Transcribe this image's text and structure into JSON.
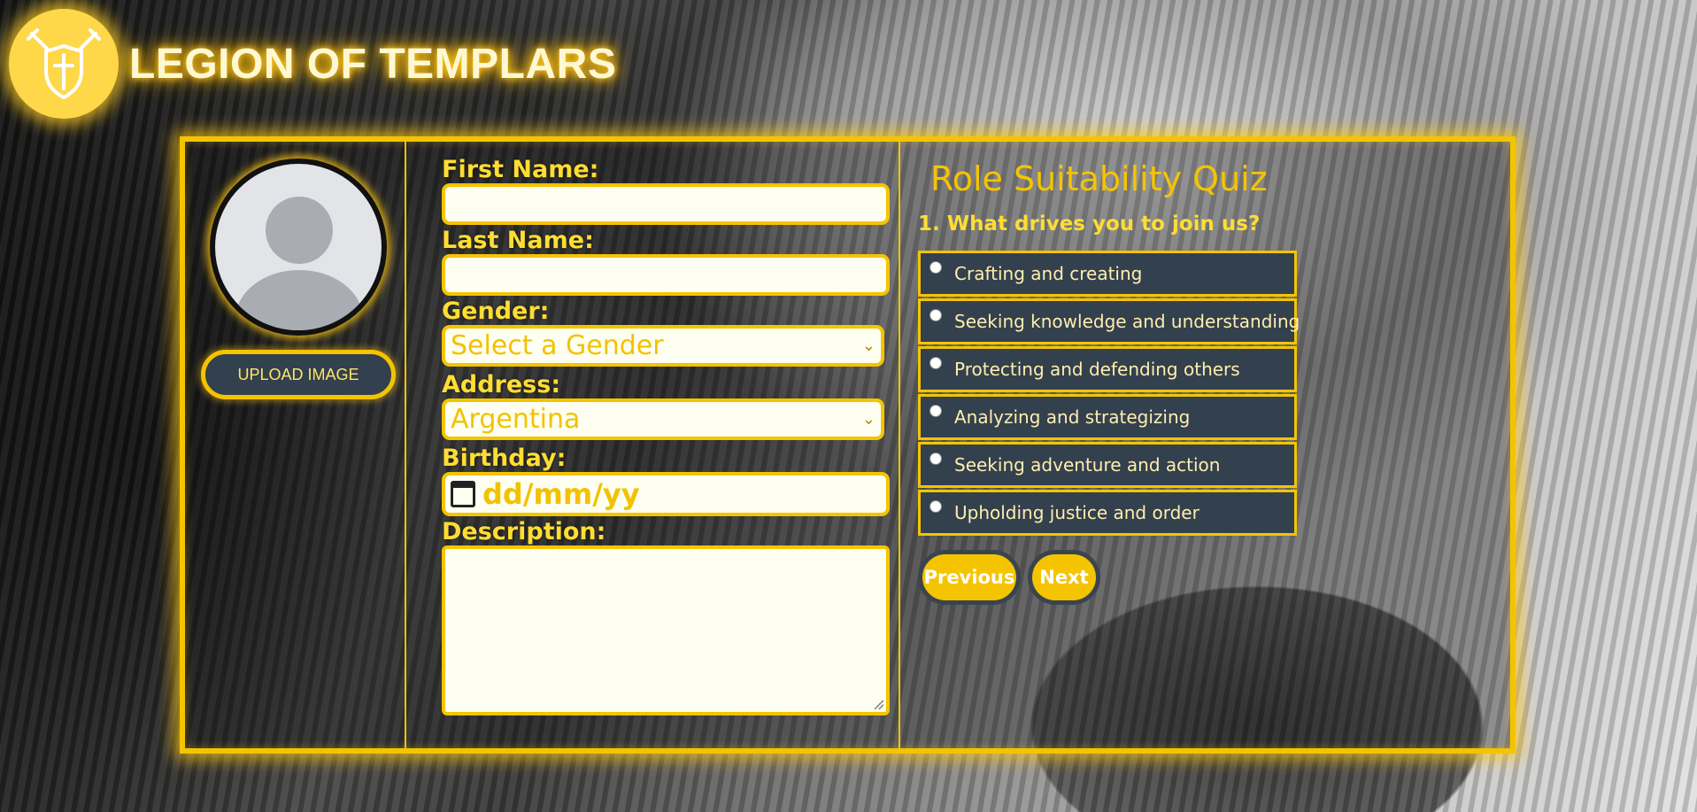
{
  "brand": {
    "title": "LEGION OF TEMPLARS",
    "logo_icon": "shield-crossed-swords-icon"
  },
  "profile": {
    "avatar_icon": "user-avatar-icon",
    "upload_label": "UPLOAD IMAGE"
  },
  "form": {
    "first_name_label": "First Name:",
    "first_name_value": "",
    "last_name_label": "Last Name:",
    "last_name_value": "",
    "gender_label": "Gender:",
    "gender_selected": "Select a Gender",
    "address_label": "Address:",
    "address_selected": "Argentina",
    "birthday_label": "Birthday:",
    "birthday_placeholder": "dd/mm/yy",
    "description_label": "Description:",
    "description_value": ""
  },
  "quiz": {
    "title": "Role Suitability Quiz",
    "question": "1. What drives you to join us?",
    "options": [
      "Crafting and creating",
      "Seeking knowledge and understanding",
      "Protecting and defending others",
      "Analyzing and strategizing",
      "Seeking adventure and action",
      "Upholding justice and order"
    ],
    "previous_label": "Previous",
    "next_label": "Next"
  },
  "colors": {
    "accent": "#f5c400",
    "panel_dark": "#33404d",
    "field_bg": "#fefff0"
  }
}
